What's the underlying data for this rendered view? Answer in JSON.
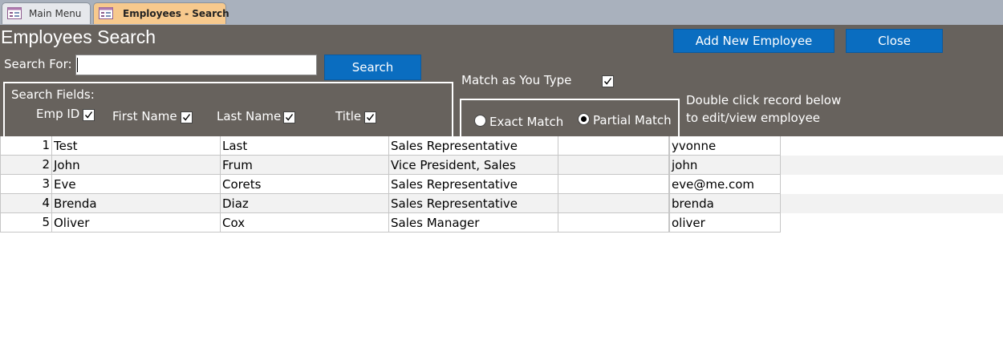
{
  "tabs": [
    {
      "label": "Main Menu",
      "active": false
    },
    {
      "label": "Employees - Search",
      "active": true
    }
  ],
  "form": {
    "title": "Employees Search",
    "add_button": "Add New Employee",
    "close_button": "Close",
    "search_label": "Search For:",
    "search_value": "",
    "search_button": "Search",
    "search_fields_label": "Search Fields:",
    "fields": [
      {
        "label": "Emp ID",
        "checked": true
      },
      {
        "label": "First Name",
        "checked": true
      },
      {
        "label": "Last Name",
        "checked": true
      },
      {
        "label": "Title",
        "checked": true
      }
    ],
    "match_as_you_type": {
      "label": "Match as You Type",
      "checked": true
    },
    "exact_match": {
      "label": "Exact Match",
      "selected": false
    },
    "partial_match": {
      "label": "Partial Match",
      "selected": true
    },
    "hint_line1": "Double click record below",
    "hint_line2": "to edit/view employee"
  },
  "records": [
    {
      "id": "1",
      "first": "Test",
      "last": "Last",
      "title": "Sales Representative",
      "blank": "",
      "email": "yvonne"
    },
    {
      "id": "2",
      "first": "John",
      "last": "Frum",
      "title": "Vice President, Sales",
      "blank": "",
      "email": "john"
    },
    {
      "id": "3",
      "first": "Eve",
      "last": "Corets",
      "title": "Sales Representative",
      "blank": "",
      "email": "eve@me.com"
    },
    {
      "id": "4",
      "first": "Brenda",
      "last": "Diaz",
      "title": "Sales Representative",
      "blank": "",
      "email": "brenda"
    },
    {
      "id": "5",
      "first": "Oliver",
      "last": "Cox",
      "title": "Sales Manager",
      "blank": "",
      "email": "oliver"
    }
  ],
  "colors": {
    "form_bg": "#67625d",
    "tab_active": "#f7c98d",
    "button": "#0a6dc0"
  }
}
